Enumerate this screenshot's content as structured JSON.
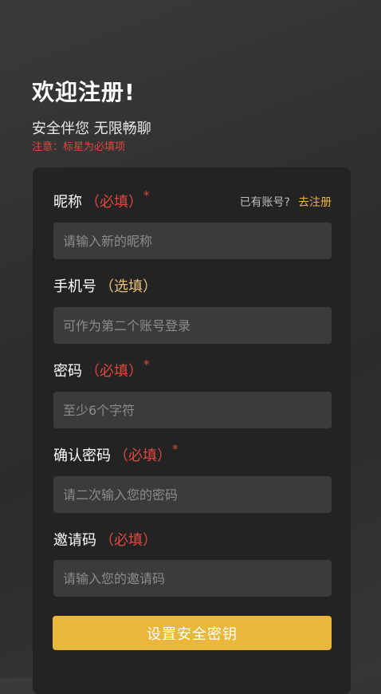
{
  "header": {
    "title": "欢迎注册!",
    "subtitle": "安全伴您 无限畅聊",
    "notice": "注意：标星为必填项"
  },
  "login_hint": {
    "question": "已有账号?",
    "link": "去注册"
  },
  "fields": [
    {
      "label": "昵称",
      "tag": "（必填）",
      "star": "*",
      "placeholder": "请输入新的昵称"
    },
    {
      "label": "手机号",
      "tag": "（选填）",
      "placeholder": "可作为第二个账号登录"
    },
    {
      "label": "密码",
      "tag": "（必填）",
      "star": "*",
      "placeholder": "至少6个字符"
    },
    {
      "label": "确认密码",
      "tag": "（必填）",
      "star": "*",
      "placeholder": "请二次输入您的密码"
    },
    {
      "label": "邀请码",
      "tag": "（必填）",
      "placeholder": "请输入您的邀请码"
    }
  ],
  "submit_label": "设置安全密钥",
  "colors": {
    "accent": "#e9b73a",
    "required": "#e0483e",
    "optional": "#e8c07a",
    "card": "#232323",
    "input": "#3b3b3b"
  }
}
